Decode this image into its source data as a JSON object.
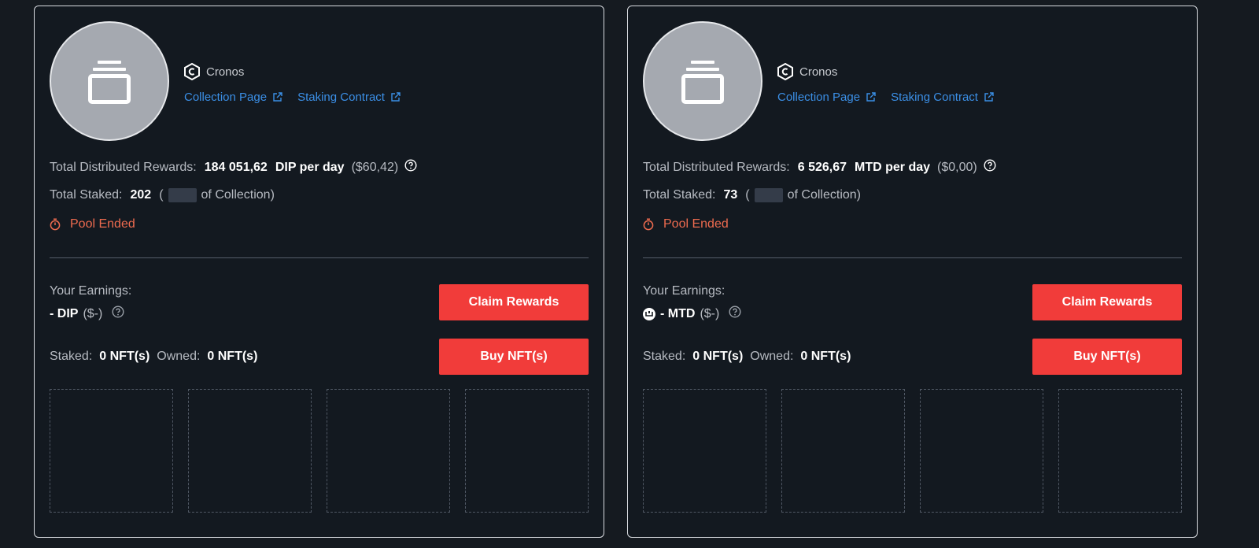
{
  "cards": [
    {
      "chain": "Cronos",
      "collection_link": "Collection Page",
      "staking_link": "Staking Contract",
      "rewards_label": "Total Distributed Rewards:",
      "rewards_value": "184 051,62",
      "rewards_unit": "DIP per day",
      "rewards_usd": "($60,42)",
      "staked_label": "Total Staked:",
      "staked_value": "202",
      "staked_open": "(",
      "staked_suffix": "of Collection)",
      "pool_status": "Pool Ended",
      "earnings_label": "Your Earnings:",
      "earnings_value": "- DIP",
      "earnings_usd": "($-)",
      "has_token_icon": false,
      "claim_label": "Claim Rewards",
      "buy_label": "Buy NFT(s)",
      "user_staked_label": "Staked:",
      "user_staked_value": "0 NFT(s)",
      "owned_label": "Owned:",
      "owned_value": "0 NFT(s)"
    },
    {
      "chain": "Cronos",
      "collection_link": "Collection Page",
      "staking_link": "Staking Contract",
      "rewards_label": "Total Distributed Rewards:",
      "rewards_value": "6 526,67",
      "rewards_unit": "MTD per day",
      "rewards_usd": "($0,00)",
      "staked_label": "Total Staked:",
      "staked_value": "73",
      "staked_open": "(",
      "staked_suffix": "of Collection)",
      "pool_status": "Pool Ended",
      "earnings_label": "Your Earnings:",
      "earnings_value": "- MTD",
      "earnings_usd": "($-)",
      "has_token_icon": true,
      "claim_label": "Claim Rewards",
      "buy_label": "Buy NFT(s)",
      "user_staked_label": "Staked:",
      "user_staked_value": "0 NFT(s)",
      "owned_label": "Owned:",
      "owned_value": "0 NFT(s)"
    }
  ],
  "icons": {
    "avatar": "collection-stack-icon",
    "chain": "cronos-logo-icon",
    "external": "external-link-icon",
    "help": "question-circle-icon",
    "timer": "stopwatch-icon",
    "token": "token-icon"
  },
  "colors": {
    "background": "#151a20",
    "card": "#131920",
    "accent_button": "#f13c3a",
    "link": "#3b8fe6",
    "pool_ended": "#ee6b4f"
  }
}
